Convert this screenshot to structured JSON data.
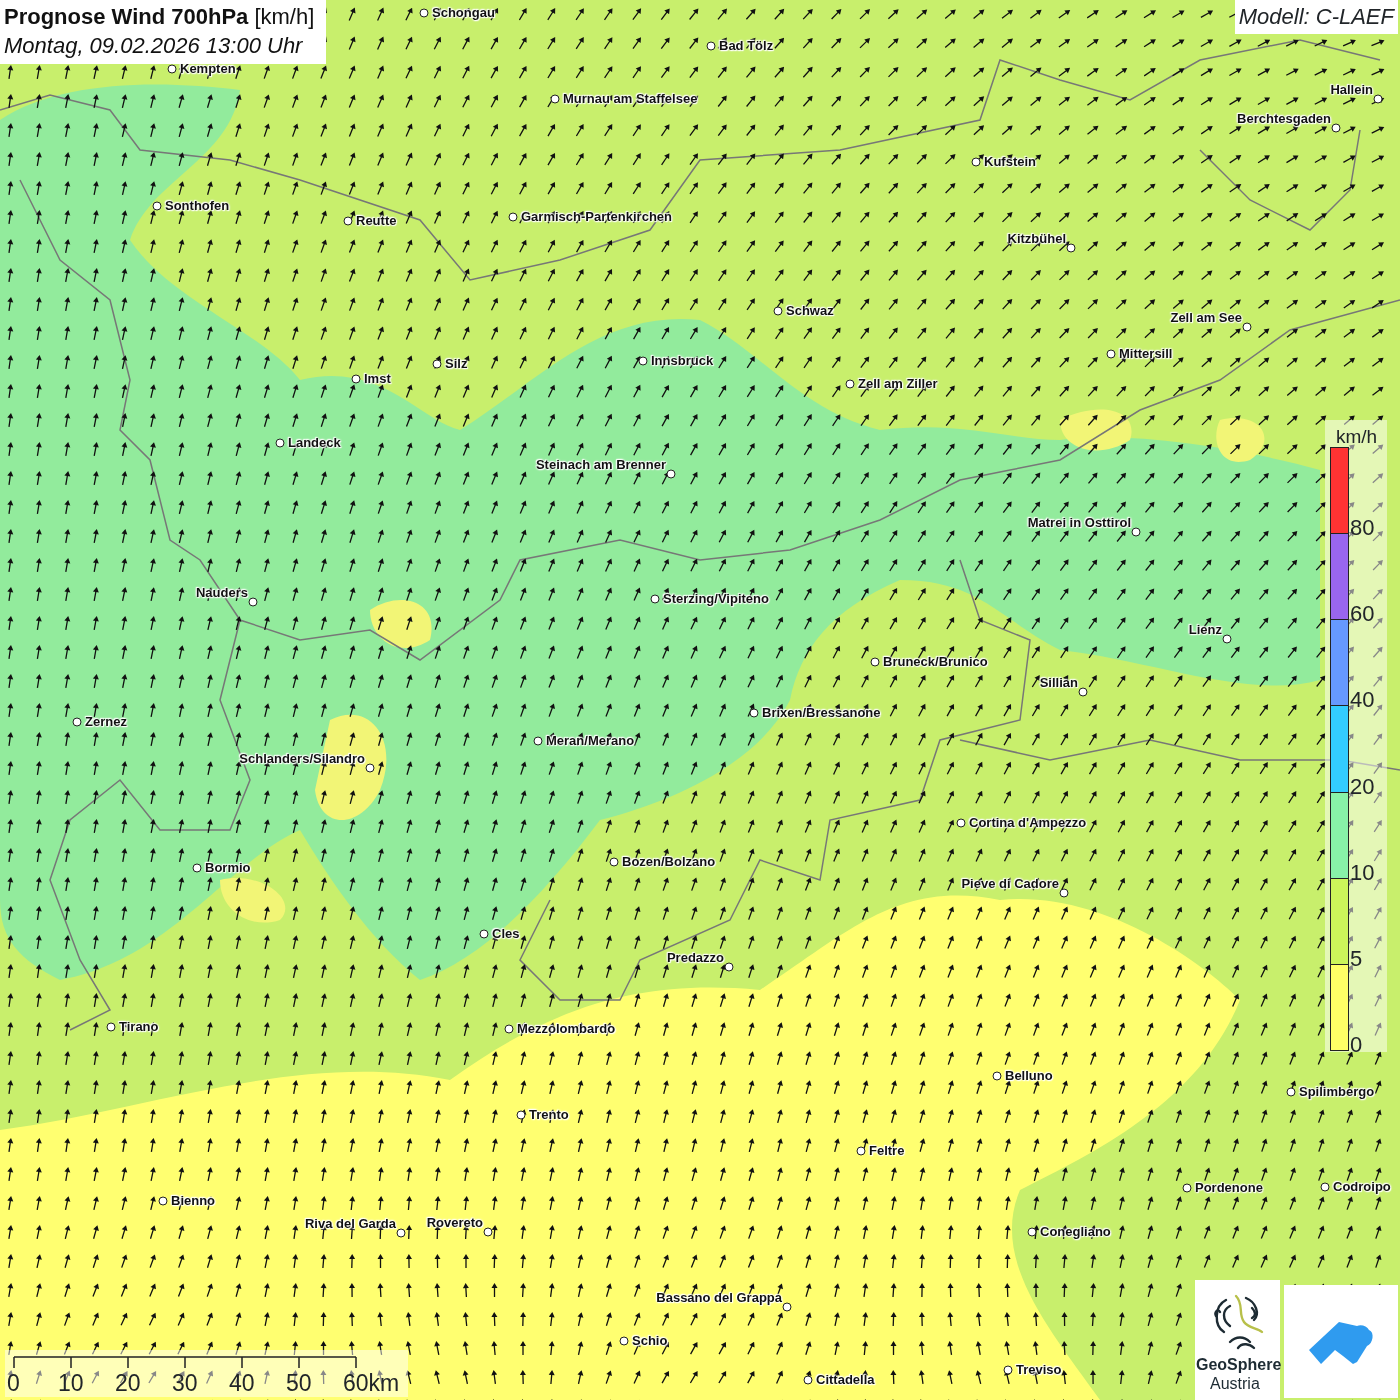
{
  "header": {
    "title": "**Prognose Wind 700hPa** [km/h]",
    "subtitle": "Montag, 09.02.2026 13:00 Uhr"
  },
  "model": "Modell: C-LAEF",
  "legend": {
    "unit": "km/h",
    "classes": [
      {
        "label": "80",
        "color": "#ff3333"
      },
      {
        "label": "60",
        "color": "#9966ee"
      },
      {
        "label": "40",
        "color": "#6699ff"
      },
      {
        "label": "20",
        "color": "#33ccff"
      },
      {
        "label": "10",
        "color": "#88f2a8"
      },
      {
        "label": "5",
        "color": "#ccf55a"
      },
      {
        "label": "0",
        "color": "#ffff66"
      }
    ]
  },
  "cities": [
    {
      "name": "Schongau"
    },
    {
      "name": "Bad Tölz"
    },
    {
      "name": "Kempten"
    },
    {
      "name": "Murnau am Staffelsee"
    },
    {
      "name": "Hallein"
    },
    {
      "name": "Berchtesgaden"
    },
    {
      "name": "Kufstein"
    },
    {
      "name": "Sonthofen"
    },
    {
      "name": "Reutte"
    },
    {
      "name": "Garmisch-Partenkirchen"
    },
    {
      "name": "Kitzbühel"
    },
    {
      "name": "Schwaz"
    },
    {
      "name": "Zell am See"
    },
    {
      "name": "Innsbruck"
    },
    {
      "name": "Mittersill"
    },
    {
      "name": "Silz"
    },
    {
      "name": "Imst"
    },
    {
      "name": "Zell am Ziller"
    },
    {
      "name": "Landeck"
    },
    {
      "name": "Steinach am Brenner"
    },
    {
      "name": "Matrei in Osttirol"
    },
    {
      "name": "Nauders"
    },
    {
      "name": "Sterzing/Vipiteno"
    },
    {
      "name": "Lienz"
    },
    {
      "name": "Bruneck/Brunico"
    },
    {
      "name": "Sillian"
    },
    {
      "name": "Zernez"
    },
    {
      "name": "Brixen/Bressanone"
    },
    {
      "name": "Meran/Merano"
    },
    {
      "name": "Schlanders/Silandro"
    },
    {
      "name": "Cortina d'Ampezzo"
    },
    {
      "name": "Bozen/Bolzano"
    },
    {
      "name": "Bormio"
    },
    {
      "name": "Pieve di Cadore"
    },
    {
      "name": "Cles"
    },
    {
      "name": "Predazzo"
    },
    {
      "name": "Tirano"
    },
    {
      "name": "Mezzolombardo"
    },
    {
      "name": "Belluno"
    },
    {
      "name": "Spilimbergo"
    },
    {
      "name": "Trento"
    },
    {
      "name": "Feltre"
    },
    {
      "name": "Pordenone"
    },
    {
      "name": "Codroipo"
    },
    {
      "name": "Bienno"
    },
    {
      "name": "Riva del Garda"
    },
    {
      "name": "Rovereto"
    },
    {
      "name": "Conegliano"
    },
    {
      "name": "Bassano del Grappa"
    },
    {
      "name": "Schio"
    },
    {
      "name": "Treviso"
    },
    {
      "name": "Cittadella"
    }
  ],
  "scale": {
    "labels": [
      "0",
      "10",
      "20",
      "30",
      "40",
      "50",
      "60km"
    ]
  },
  "logo": {
    "line_1": "GeoSphere",
    "line_2": "Austria"
  }
}
